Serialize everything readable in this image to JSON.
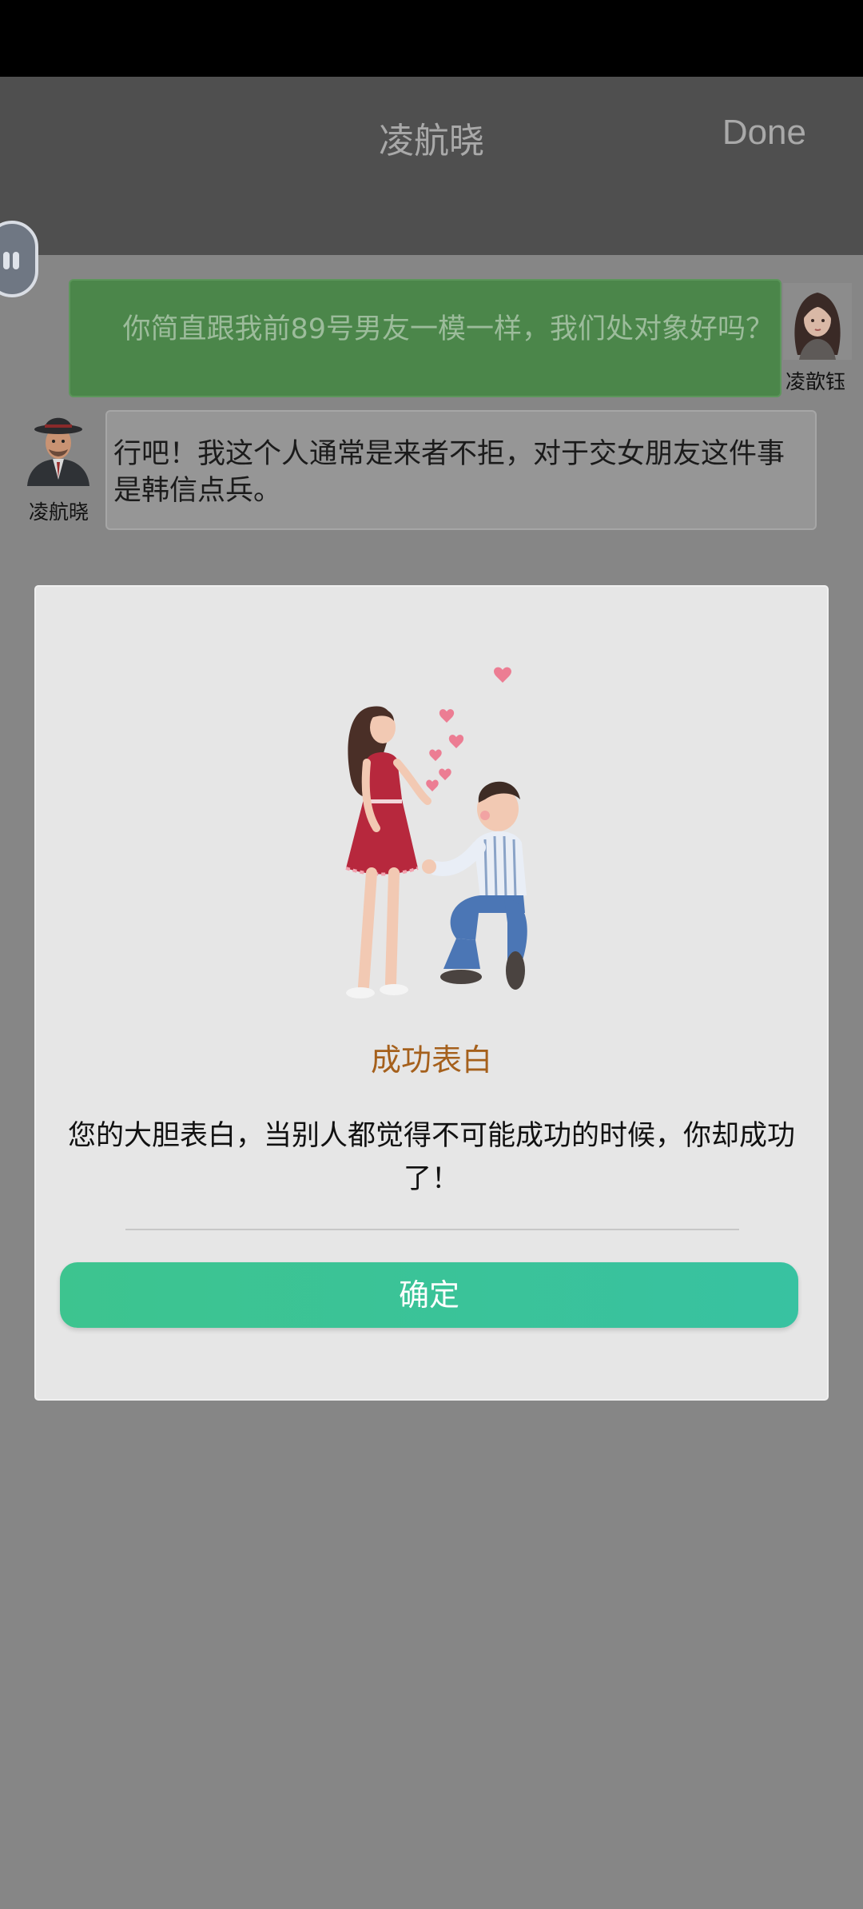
{
  "header": {
    "title": "凌航晓",
    "done_label": "Done"
  },
  "chat": {
    "messages": [
      {
        "sender": "凌歆钰",
        "text": "你简直跟我前89号男友一模一样，我们处对象好吗？",
        "direction": "outgoing"
      },
      {
        "sender": "凌航晓",
        "text": "行吧！我这个人通常是来者不拒，对于交女朋友这件事是韩信点兵。",
        "direction": "incoming"
      }
    ]
  },
  "dialog": {
    "illustration": "proposal-couple-illustration",
    "title": "成功表白",
    "message": "您的大胆表白，当别人都觉得不可能成功的时候，你却成功了！",
    "confirm_label": "确定"
  },
  "colors": {
    "overlay": "#868686",
    "outgoing_bubble": "#4b864a",
    "dialog_title": "#a5601c",
    "confirm_button": "#3dc48f"
  }
}
